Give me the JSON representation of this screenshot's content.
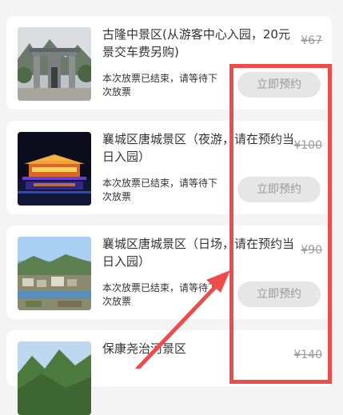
{
  "cards": [
    {
      "title": "古隆中景区(从游客中心入园，20元景交车费另购)",
      "old_price": "¥67",
      "status": "本次放票已结束，请等待下次放票",
      "button": "立即预约",
      "thumb_icon": "scenic-gate-photo"
    },
    {
      "title": "襄城区唐城景区（夜游，请在预约当日入园）",
      "old_price": "¥100",
      "status": "本次放票已结束，请等待下次放票",
      "button": "立即预约",
      "thumb_icon": "night-palace-photo"
    },
    {
      "title": "襄城区唐城景区（日场，请在预约当日入园）",
      "old_price": "¥90",
      "status": "本次放票已结束，请等待下次放票",
      "button": "立即预约",
      "thumb_icon": "city-aerial-photo"
    },
    {
      "title": "保康尧治河景区",
      "old_price": "¥140",
      "thumb_icon": "mountain-photo"
    }
  ],
  "annotation": {
    "color": "#ee4b4b"
  }
}
